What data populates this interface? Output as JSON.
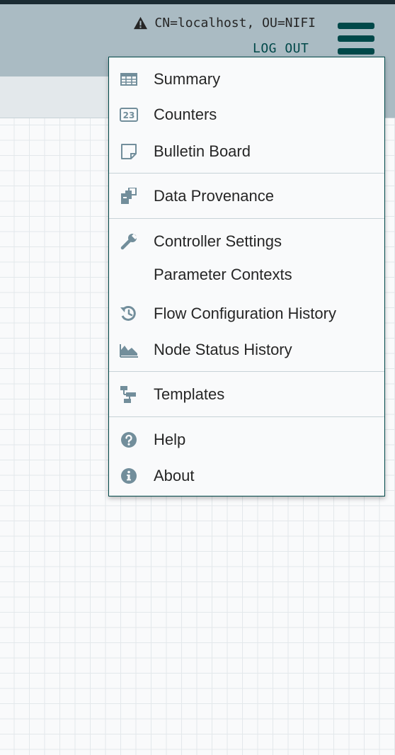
{
  "header": {
    "user_identity": "CN=localhost, OU=NIFI",
    "logout_label": "LOG OUT"
  },
  "menu": {
    "items": [
      {
        "id": "summary",
        "label": "Summary",
        "icon": "table-icon"
      },
      {
        "id": "counters",
        "label": "Counters",
        "icon": "counters-icon"
      },
      {
        "id": "bulletin",
        "label": "Bulletin Board",
        "icon": "sticky-note-icon"
      },
      {
        "id": "provenance",
        "label": "Data Provenance",
        "icon": "provenance-icon"
      },
      {
        "id": "controller",
        "label": "Controller Settings",
        "icon": "wrench-icon"
      },
      {
        "id": "parameters",
        "label": "Parameter Contexts",
        "icon": ""
      },
      {
        "id": "flowhistory",
        "label": "Flow Configuration History",
        "icon": "history-icon"
      },
      {
        "id": "nodestatus",
        "label": "Node Status History",
        "icon": "area-chart-icon"
      },
      {
        "id": "templates",
        "label": "Templates",
        "icon": "templates-icon"
      },
      {
        "id": "help",
        "label": "Help",
        "icon": "question-circle-icon"
      },
      {
        "id": "about",
        "label": "About",
        "icon": "info-circle-icon"
      }
    ]
  },
  "colors": {
    "accent": "#004849",
    "header_bg": "#aabbc3",
    "icon": "#728e9b",
    "canvas_bg": "#f9fafb"
  }
}
